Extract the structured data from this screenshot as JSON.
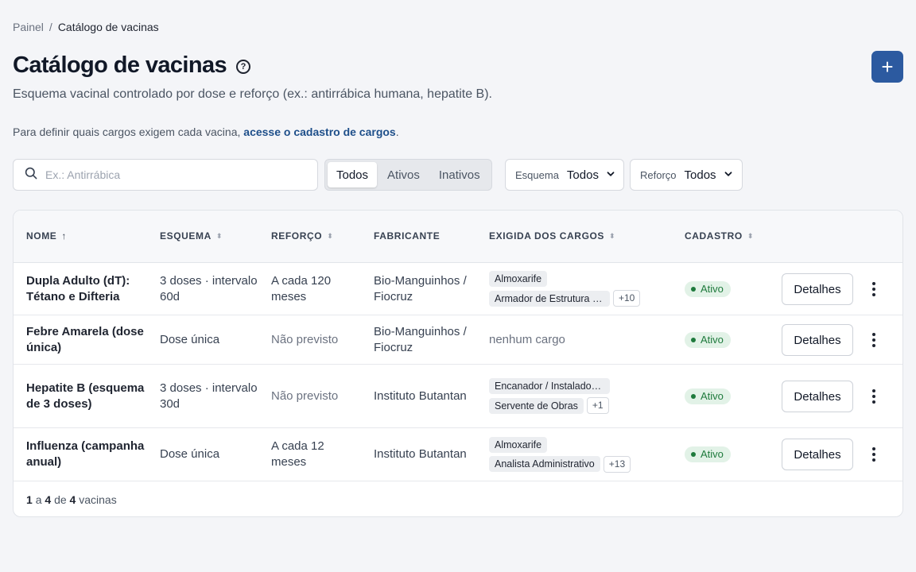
{
  "breadcrumb": {
    "root": "Painel",
    "separator": "/",
    "current": "Catálogo de vacinas"
  },
  "header": {
    "title": "Catálogo de vacinas",
    "help_icon": "?",
    "subtitle": "Esquema vacinal controlado por dose e reforço (ex.: antirrábica humana, hepatite B).",
    "info_text": "Para definir quais cargos exigem cada vacina,",
    "info_link": "acesse o cadastro de cargos",
    "info_end": ".",
    "add_icon": "+"
  },
  "filters": {
    "search_placeholder": "Ex.: Antirrábica",
    "status_tabs": [
      "Todos",
      "Ativos",
      "Inativos"
    ],
    "status_active": "Todos",
    "esquema_label": "Esquema",
    "esquema_value": "Todos",
    "reforco_label": "Reforço",
    "reforco_value": "Todos"
  },
  "table": {
    "columns": {
      "nome": "NOME",
      "esquema": "ESQUEMA",
      "reforco": "REFORÇO",
      "fabricante": "FABRICANTE",
      "cargos": "EXIGIDA DOS CARGOS",
      "cadastro": "CADASTRO"
    },
    "details_label": "Detalhes",
    "rows": [
      {
        "nome": "Dupla Adulto (dT): Tétano e Difteria",
        "esquema": "3 doses · intervalo 60d",
        "reforco": "A cada 120 meses",
        "fabricante": "Bio-Manguinhos / Fiocruz",
        "cargo1": "Almoxarife",
        "cargo2": "Armador de Estrutura de Concreto",
        "cargos_more": "+10",
        "status": "Ativo"
      },
      {
        "nome": "Febre Amarela (dose única)",
        "esquema": "Dose única",
        "reforco": "Não previsto",
        "fabricante": "Bio-Manguinhos / Fiocruz",
        "cargos_none": "nenhum cargo",
        "status": "Ativo"
      },
      {
        "nome": "Hepatite B (esquema de 3 doses)",
        "esquema": "3 doses · intervalo 30d",
        "reforco": "Não previsto",
        "fabricante": "Instituto Butantan",
        "cargo1": "Encanador / Instalador Hidráulico",
        "cargo2": "Servente de Obras",
        "cargos_more": "+1",
        "status": "Ativo"
      },
      {
        "nome": "Influenza (campanha anual)",
        "esquema": "Dose única",
        "reforco": "A cada 12 meses",
        "fabricante": "Instituto Butantan",
        "cargo1": "Almoxarife",
        "cargo2": "Analista Administrativo",
        "cargos_more": "+13",
        "status": "Ativo"
      }
    ]
  },
  "footer": {
    "from": "1",
    "to": "4",
    "a": "a",
    "de": "de",
    "total": "4",
    "unit": "vacinas"
  },
  "colors": {
    "accent": "#2c5aa0",
    "link": "#1e4f8a",
    "status_active_bg": "#e2f2e7",
    "status_active_fg": "#1e7a3c"
  }
}
